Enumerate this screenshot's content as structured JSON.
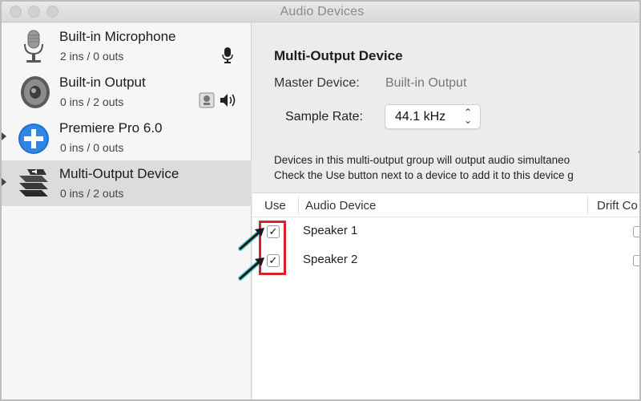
{
  "window": {
    "title": "Audio Devices"
  },
  "devices": [
    {
      "name": "Built-in Microphone",
      "io": "2 ins / 0 outs",
      "icon": "microphone-icon"
    },
    {
      "name": "Built-in Output",
      "io": "0 ins / 2 outs",
      "icon": "speaker-icon"
    },
    {
      "name": "Premiere Pro 6.0",
      "io": "0 ins / 0 outs",
      "icon": "plus-circle-icon"
    },
    {
      "name": "Multi-Output Device",
      "io": "0 ins / 2 outs",
      "icon": "multi-output-icon",
      "selected": true
    }
  ],
  "main": {
    "title": "Multi-Output Device",
    "master_label": "Master Device:",
    "master_value": "Built-in Output",
    "rate_label": "Sample Rate:",
    "rate_value": "44.1 kHz",
    "desc_line1": "Devices in this multi-output group will output audio simultaneo",
    "desc_line2": "Check the Use button next to a device to add it to this device g"
  },
  "table": {
    "columns": [
      "Use",
      "Audio Device",
      "Drift Co"
    ],
    "rows": [
      {
        "use": true,
        "device": "Speaker 1"
      },
      {
        "use": true,
        "device": "Speaker 2"
      }
    ]
  },
  "colors": {
    "highlight": "#d8222a",
    "annotation_arrow": "#1a1a1a",
    "arrow_glow": "#19c9c9",
    "selected_row": "#dcdcdc"
  }
}
